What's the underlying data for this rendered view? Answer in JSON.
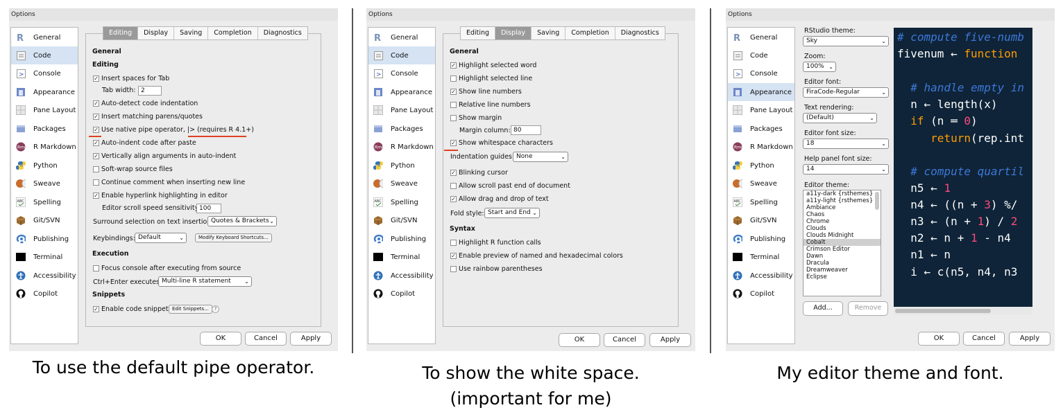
{
  "window_title": "Options",
  "sidebar": [
    {
      "label": "General",
      "icon": "r-logo-icon"
    },
    {
      "label": "Code",
      "icon": "code-icon"
    },
    {
      "label": "Console",
      "icon": "console-icon"
    },
    {
      "label": "Appearance",
      "icon": "appearance-icon"
    },
    {
      "label": "Pane Layout",
      "icon": "pane-layout-icon"
    },
    {
      "label": "Packages",
      "icon": "packages-icon"
    },
    {
      "label": "R Markdown",
      "icon": "rmarkdown-icon"
    },
    {
      "label": "Python",
      "icon": "python-icon"
    },
    {
      "label": "Sweave",
      "icon": "sweave-icon"
    },
    {
      "label": "Spelling",
      "icon": "spelling-icon"
    },
    {
      "label": "Git/SVN",
      "icon": "git-icon"
    },
    {
      "label": "Publishing",
      "icon": "publishing-icon"
    },
    {
      "label": "Terminal",
      "icon": "terminal-icon"
    },
    {
      "label": "Accessibility",
      "icon": "accessibility-icon"
    },
    {
      "label": "Copilot",
      "icon": "copilot-icon"
    }
  ],
  "tabs": [
    "Editing",
    "Display",
    "Saving",
    "Completion",
    "Diagnostics"
  ],
  "buttons": {
    "ok": "OK",
    "cancel": "Cancel",
    "apply": "Apply"
  },
  "panel1": {
    "general": "General",
    "editing": "Editing",
    "insert_spaces": "Insert spaces for Tab",
    "tab_width_label": "Tab width:",
    "tab_width_value": "2",
    "auto_detect": "Auto-detect code indentation",
    "matching_parens": "Insert matching parens/quotes",
    "native_pipe": "Use native pipe operator, |> (requires R 4.1+)",
    "auto_indent": "Auto-indent code after paste",
    "vertical_align": "Vertically align arguments in auto-indent",
    "soft_wrap": "Soft-wrap source files",
    "continue_comment": "Continue comment when inserting new line",
    "hyperlink": "Enable hyperlink highlighting in editor",
    "scroll_label": "Editor scroll speed sensitivity:",
    "scroll_value": "100",
    "surround_label": "Surround selection on text insertion:",
    "surround_value": "Quotes & Brackets",
    "keybindings_label": "Keybindings:",
    "keybindings_value": "Default",
    "modify_shortcuts": "Modify Keyboard Shortcuts...",
    "execution": "Execution",
    "focus_console": "Focus console after executing from source",
    "ctrl_enter_label": "Ctrl+Enter executes:",
    "ctrl_enter_value": "Multi-line R statement",
    "snippets": "Snippets",
    "enable_snippets": "Enable code snippets",
    "edit_snippets": "Edit Snippets...",
    "help": "?"
  },
  "panel2": {
    "general": "General",
    "highlight_word": "Highlight selected word",
    "highlight_line": "Highlight selected line",
    "show_line_numbers": "Show line numbers",
    "relative_line_numbers": "Relative line numbers",
    "show_margin": "Show margin",
    "margin_label": "Margin column:",
    "margin_value": "80",
    "show_whitespace": "Show whitespace characters",
    "indent_guides_label": "Indentation guides:",
    "indent_guides_value": "None",
    "blinking_cursor": "Blinking cursor",
    "scroll_past": "Allow scroll past end of document",
    "drag_drop": "Allow drag and drop of text",
    "fold_label": "Fold style:",
    "fold_value": "Start and End",
    "syntax": "Syntax",
    "highlight_r": "Highlight R function calls",
    "preview_colors": "Enable preview of named and hexadecimal colors",
    "rainbow": "Use rainbow parentheses"
  },
  "panel3": {
    "theme_label": "RStudio theme:",
    "theme_value": "Sky",
    "zoom_label": "Zoom:",
    "zoom_value": "100%",
    "font_label": "Editor font:",
    "font_value": "FiraCode-Regular",
    "render_label": "Text rendering:",
    "render_value": "(Default)",
    "font_size_label": "Editor font size:",
    "font_size_value": "18",
    "help_size_label": "Help panel font size:",
    "help_size_value": "14",
    "editor_theme_label": "Editor theme:",
    "themes": [
      "a11y-dark {rsthemes}",
      "a11y-light {rsthemes}",
      "Ambiance",
      "Chaos",
      "Chrome",
      "Clouds",
      "Clouds Midnight",
      "Cobalt",
      "Crimson Editor",
      "Dawn",
      "Dracula",
      "Dreamweaver",
      "Eclipse"
    ],
    "add": "Add...",
    "remove": "Remove",
    "code": {
      "l1": "# compute five-numb",
      "l2a": "fivenum ← ",
      "l2b": "function",
      "l3": "  # handle empty in",
      "l4": "  n ← length(x)",
      "l5a": "  ",
      "l5b": "if",
      "l5c": " (n ═ ",
      "l5d": "0",
      "l5e": ")",
      "l6a": "     ",
      "l6b": "return",
      "l6c": "(rep.int",
      "l7": "  # compute quartil",
      "l8a": "  n5 ← ",
      "l8b": "1",
      "l9a": "  n4 ← ((n + ",
      "l9b": "3",
      "l9c": ") %/",
      "l10a": "  n3 ← (n + ",
      "l10b": "1",
      "l10c": ") / ",
      "l10d": "2",
      "l11a": "  n2 ← n + ",
      "l11b": "1",
      "l11c": " - n4",
      "l12": "  n1 ← n",
      "l13": "  i ← c(n5, n4, n3"
    }
  },
  "captions": {
    "c1": "To use the default pipe operator.",
    "c2a": "To show the white space.",
    "c2b": "(important for me)",
    "c3": "My editor theme and font."
  }
}
